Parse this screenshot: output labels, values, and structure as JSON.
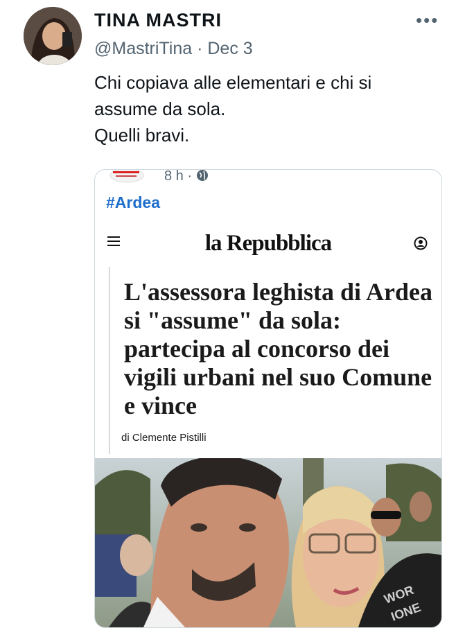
{
  "author": {
    "name": "TINA MASTRI",
    "handle": "@MastriTina",
    "separator": "·",
    "date": "Dec 3"
  },
  "tweet": {
    "lines": [
      "Chi copiava alle elementari e chi si",
      "assume da sola.",
      "Quelli bravi."
    ]
  },
  "more_icon": "more-horizontal-icon",
  "card": {
    "time": "8 h ·",
    "hashtag": "#Ardea",
    "masthead": "la Repubblica",
    "headline": "L'assessora leghista di Ardea si \"assume\" da sola: partecipa al concorso dei vigili urbani nel suo Comune e vince",
    "byline": "di Clemente Pistilli"
  },
  "colors": {
    "link": "#1d6ecc",
    "muted": "#536471",
    "text": "#0f1419"
  }
}
